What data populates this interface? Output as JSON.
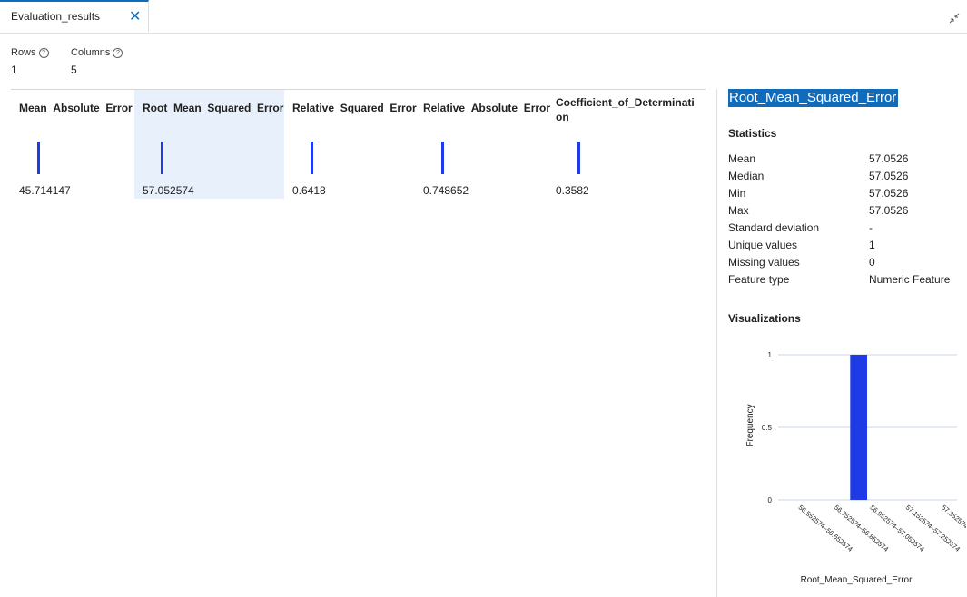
{
  "tab": {
    "label": "Evaluation_results",
    "close": "✕"
  },
  "meta": {
    "rows_label": "Rows",
    "rows_value": "1",
    "columns_label": "Columns",
    "columns_value": "5",
    "help_glyph": "?"
  },
  "columns": [
    {
      "name": "Mean_Absolute_Error",
      "value": "45.714147"
    },
    {
      "name": "Root_Mean_Squared_Error",
      "value": "57.052574",
      "selected": true
    },
    {
      "name": "Relative_Squared_Error",
      "value": "0.6418"
    },
    {
      "name": "Relative_Absolute_Error",
      "value": "0.748652"
    },
    {
      "name": "Coefficient_of_Determination",
      "value": "0.3582"
    }
  ],
  "panel": {
    "title": "Root_Mean_Squared_Error",
    "statistics_heading": "Statistics",
    "stats": [
      {
        "label": "Mean",
        "value": "57.0526"
      },
      {
        "label": "Median",
        "value": "57.0526"
      },
      {
        "label": "Min",
        "value": "57.0526"
      },
      {
        "label": "Max",
        "value": "57.0526"
      },
      {
        "label": "Standard deviation",
        "value": "-"
      },
      {
        "label": "Unique values",
        "value": "1"
      },
      {
        "label": "Missing values",
        "value": "0"
      },
      {
        "label": "Feature type",
        "value": "Numeric Feature"
      }
    ],
    "visualizations_heading": "Visualizations"
  },
  "chart_data": {
    "type": "bar",
    "categories": [
      "56.55257‑56.65257",
      "56.75257‑56.85257",
      "56.95257‑57.05257",
      "57.15257‑57.25257",
      "57.35257‑57.45257"
    ],
    "tick_categories": [
      "56.552574–56.652574",
      "56.752574–56.852574",
      "56.952574–57.052574",
      "57.152574–57.252574",
      "57.352574–57.452574"
    ],
    "bins": 10,
    "values": [
      0,
      0,
      0,
      0,
      1,
      0,
      0,
      0,
      0,
      0
    ],
    "xlabel": "Root_Mean_Squared_Error",
    "ylabel": "Frequency",
    "ylim": [
      0,
      1
    ],
    "yticks": [
      "0",
      "0.5",
      "1"
    ],
    "grid": true,
    "bar_color": "#1f3be5"
  }
}
